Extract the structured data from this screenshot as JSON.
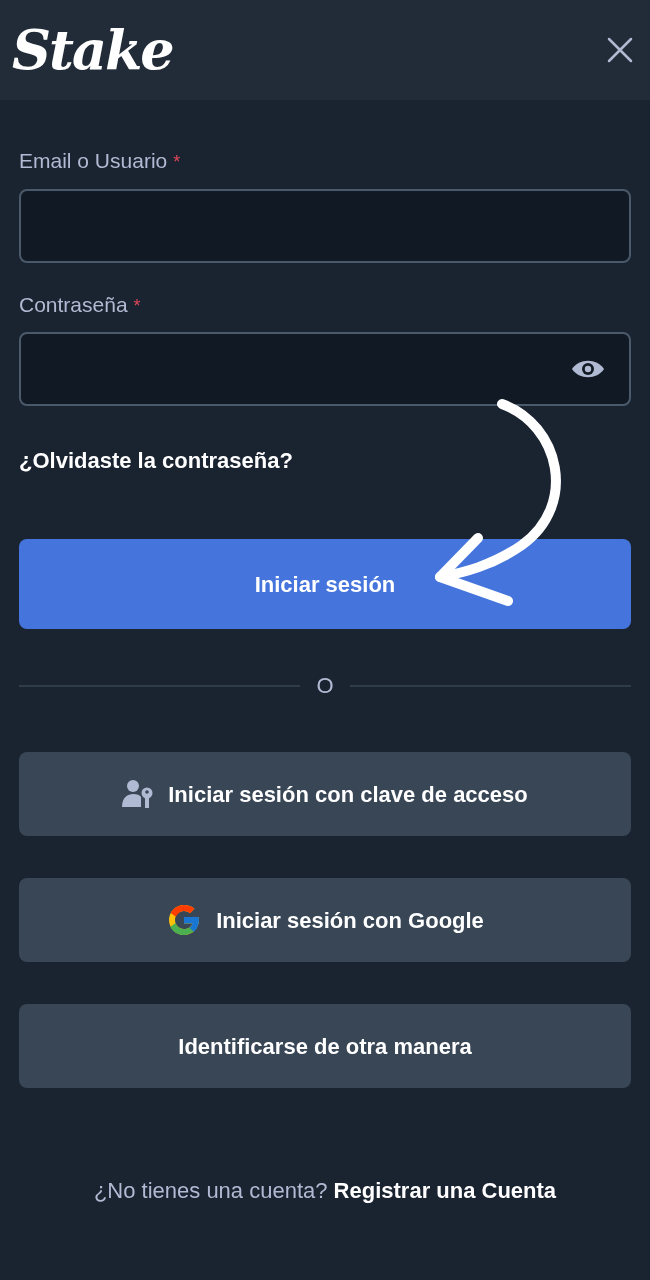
{
  "header": {
    "logo": "Stake"
  },
  "fields": [
    {
      "label": "Email o Usuario",
      "required_mark": "*",
      "kind": "text"
    },
    {
      "label": "Contraseña",
      "required_mark": "*",
      "kind": "password"
    }
  ],
  "forgot_link": "¿Olvidaste la contraseña?",
  "primary_button": "Iniciar sesión",
  "divider_text": "O",
  "alt_buttons": [
    {
      "label": "Iniciar sesión con clave de acceso",
      "kind": "passkey"
    },
    {
      "label": "Iniciar sesión con Google",
      "kind": "google"
    },
    {
      "label": "Identificarse de otra manera",
      "kind": "plain"
    }
  ],
  "footer": {
    "prompt": "¿No tienes una cuenta?",
    "link": "Registrar una Cuenta"
  },
  "annotation": {
    "kind": "arrow"
  }
}
